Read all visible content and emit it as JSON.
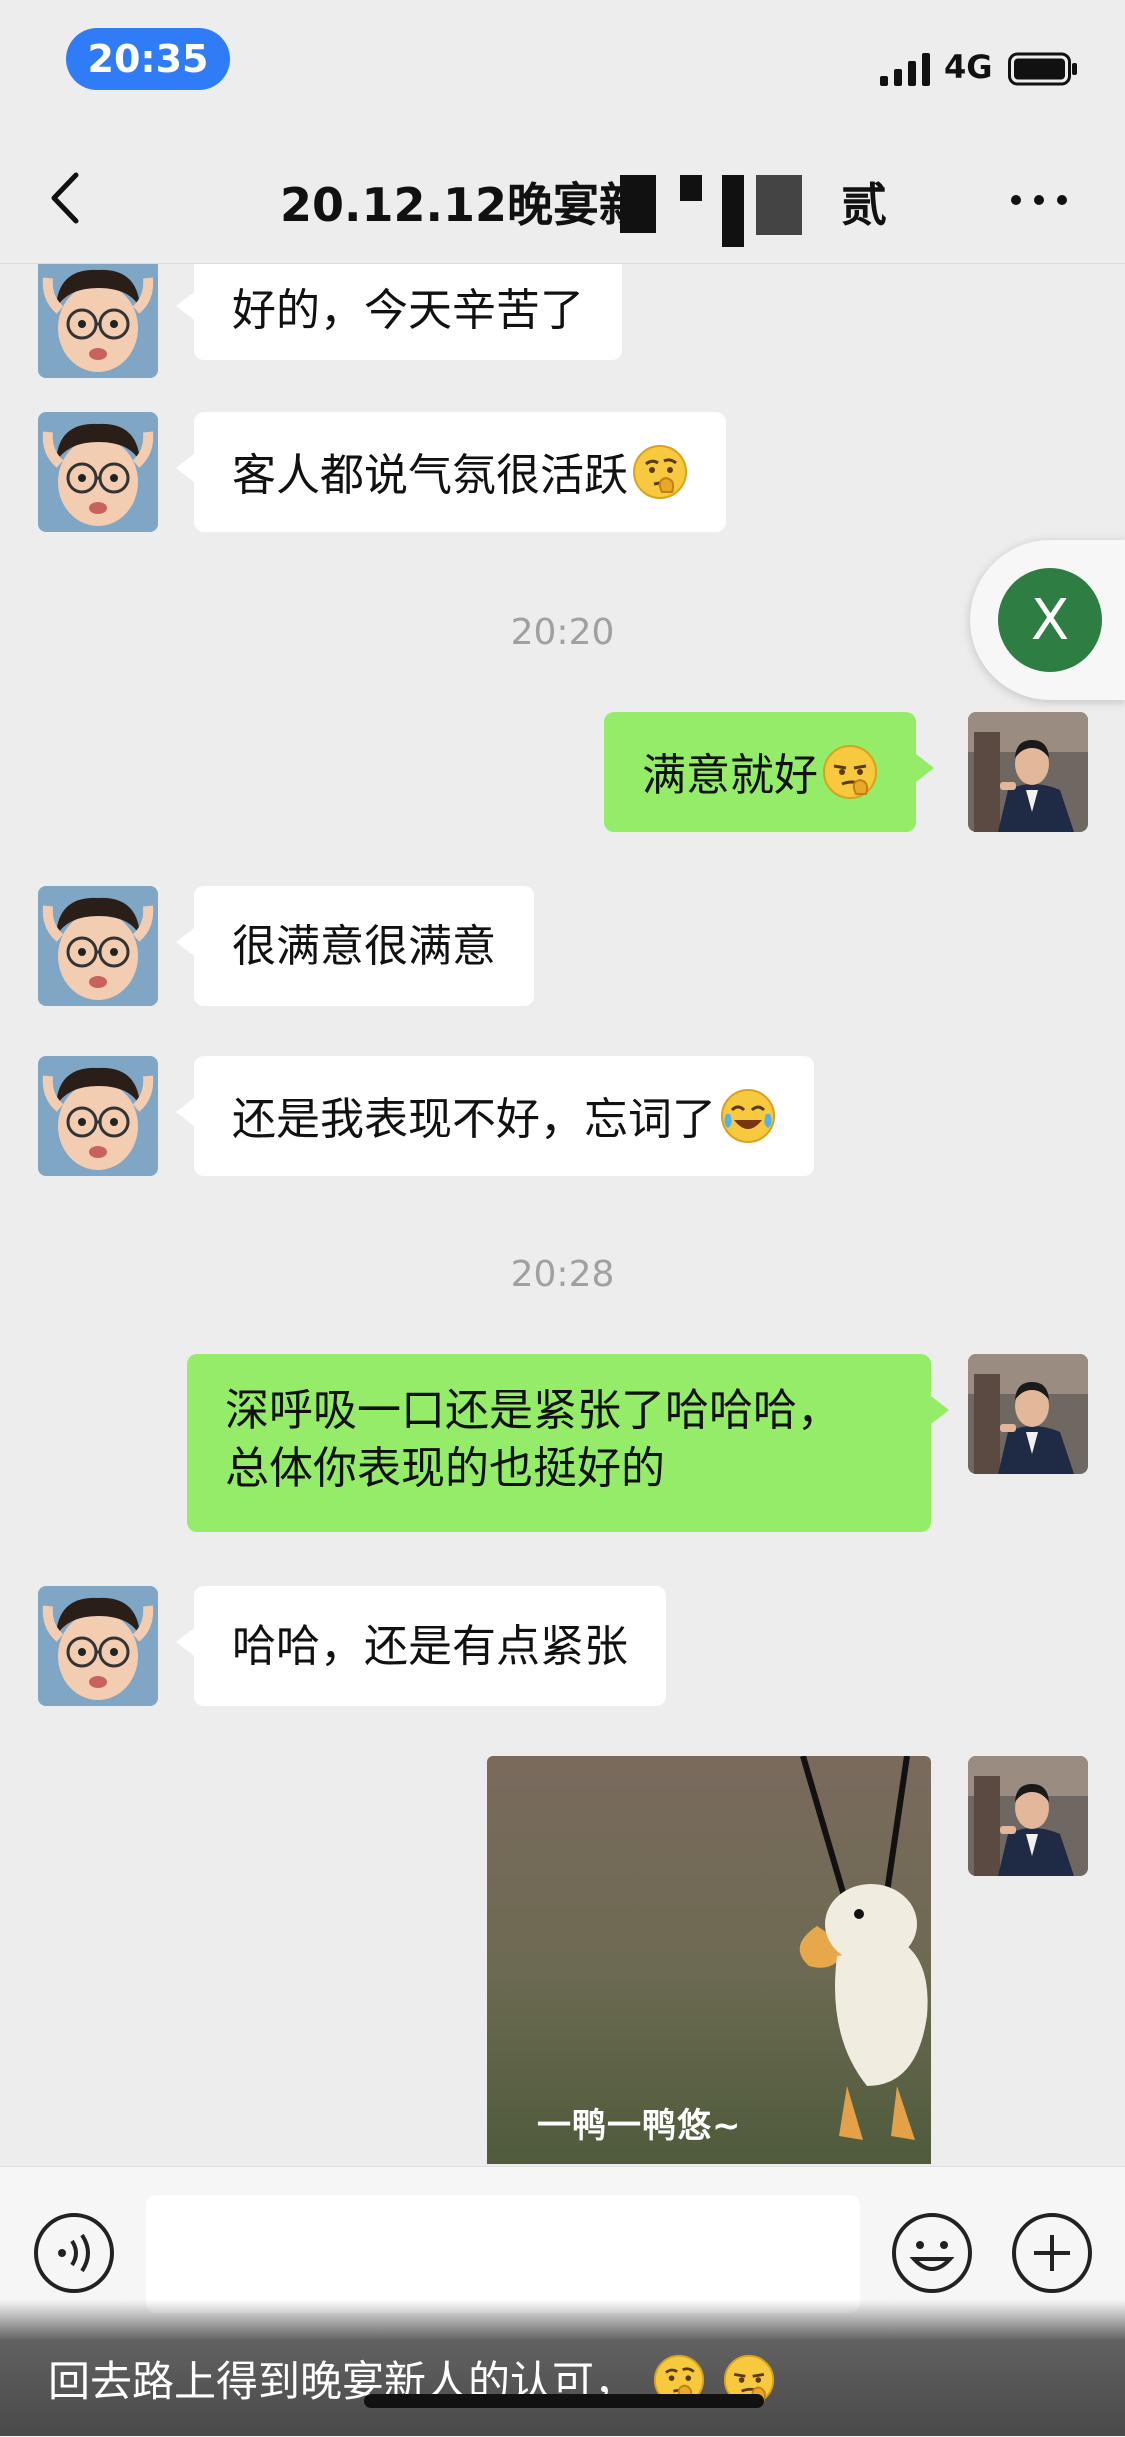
{
  "status": {
    "time": "20:35",
    "network": "4G"
  },
  "header": {
    "title_visible": "20.12.12晚宴新",
    "title_tail": "贰"
  },
  "messages": [
    {
      "side": "in",
      "text": "好的，今天辛苦了"
    },
    {
      "side": "in",
      "text": "客人都说气氛很活跃",
      "emoji": "thinking-face-icon"
    },
    {
      "timestamp": "20:20"
    },
    {
      "side": "out",
      "text": "满意就好",
      "emoji": "smirk-face-icon"
    },
    {
      "side": "in",
      "text": "很满意很满意"
    },
    {
      "side": "in",
      "text": "还是我表现不好，忘词了",
      "emoji": "laughing-tears-icon"
    },
    {
      "timestamp": "20:28"
    },
    {
      "side": "out",
      "lines": [
        "深呼吸一口还是紧张了哈哈哈，",
        "总体你表现的也挺好的"
      ]
    },
    {
      "side": "in",
      "text": "哈哈，还是有点紧张"
    },
    {
      "side": "out",
      "sticker_caption": "一鸭一鸭悠~"
    }
  ],
  "floating_close": {
    "label": "X"
  },
  "caption": {
    "text": "回去路上得到晚宴新人的认可，"
  },
  "colors": {
    "outgoing_bubble": "#95ec69",
    "incoming_bubble": "#ffffff",
    "background": "#ededed",
    "time_pill": "#2f7cf6",
    "float_button": "#2e7d43"
  }
}
